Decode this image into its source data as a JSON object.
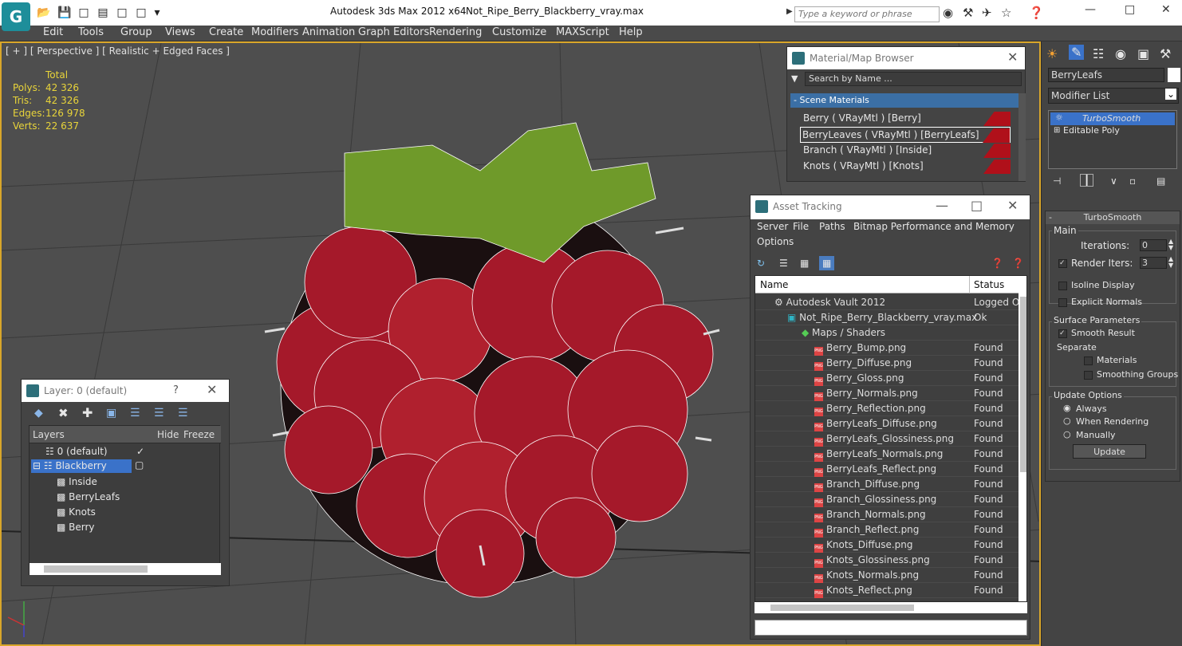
{
  "app": {
    "product": "Autodesk 3ds Max  2012 x64",
    "file": "Not_Ripe_Berry_Blackberry_vray.max",
    "search_placeholder": "Type a keyword or phrase"
  },
  "menu": [
    "Edit",
    "Tools",
    "Group",
    "Views",
    "Create",
    "Modifiers",
    "Animation",
    "Graph Editors",
    "Rendering",
    "Customize",
    "MAXScript",
    "Help"
  ],
  "viewport": {
    "label": "[ + ] [ Perspective ] [ Realistic + Edged Faces ]",
    "stats_header": "Total",
    "stats": [
      {
        "label": "Polys:",
        "value": "42 326"
      },
      {
        "label": "Tris:",
        "value": "42 326"
      },
      {
        "label": "Edges:",
        "value": "126 978"
      },
      {
        "label": "Verts:",
        "value": "22 637"
      }
    ]
  },
  "material_browser": {
    "title": "Material/Map Browser",
    "search": "Search by Name ...",
    "group": "- Scene Materials",
    "items": [
      "Berry  ( VRayMtl ) [Berry]",
      "BerryLeaves  ( VRayMtl ) [BerryLeafs]",
      "Branch  ( VRayMtl ) [Inside]",
      "Knots  ( VRayMtl ) [Knots]"
    ]
  },
  "asset_tracking": {
    "title": "Asset Tracking",
    "menus": [
      "Server",
      "File",
      "Paths",
      "Bitmap Performance and Memory",
      "Options"
    ],
    "col_name": "Name",
    "col_status": "Status",
    "rows": [
      {
        "name": "Autodesk Vault 2012",
        "status": "Logged O"
      },
      {
        "name": "Not_Ripe_Berry_Blackberry_vray.max",
        "status": "Ok"
      },
      {
        "name": "Maps / Shaders",
        "status": ""
      },
      {
        "name": "Berry_Bump.png",
        "status": "Found"
      },
      {
        "name": "Berry_Diffuse.png",
        "status": "Found"
      },
      {
        "name": "Berry_Gloss.png",
        "status": "Found"
      },
      {
        "name": "Berry_Normals.png",
        "status": "Found"
      },
      {
        "name": "Berry_Reflection.png",
        "status": "Found"
      },
      {
        "name": "BerryLeafs_Diffuse.png",
        "status": "Found"
      },
      {
        "name": "BerryLeafs_Glossiness.png",
        "status": "Found"
      },
      {
        "name": "BerryLeafs_Normals.png",
        "status": "Found"
      },
      {
        "name": "BerryLeafs_Reflect.png",
        "status": "Found"
      },
      {
        "name": "Branch_Diffuse.png",
        "status": "Found"
      },
      {
        "name": "Branch_Glossiness.png",
        "status": "Found"
      },
      {
        "name": "Branch_Normals.png",
        "status": "Found"
      },
      {
        "name": "Branch_Reflect.png",
        "status": "Found"
      },
      {
        "name": "Knots_Diffuse.png",
        "status": "Found"
      },
      {
        "name": "Knots_Glossiness.png",
        "status": "Found"
      },
      {
        "name": "Knots_Normals.png",
        "status": "Found"
      },
      {
        "name": "Knots_Reflect.png",
        "status": "Found"
      }
    ]
  },
  "layer_panel": {
    "title": "Layer: 0 (default)",
    "help": "?",
    "col_layers": "Layers",
    "col_hide": "Hide",
    "col_freeze": "Freeze",
    "rows": [
      "0 (default)",
      "Blackberry",
      "Inside",
      "BerryLeafs",
      "Knots",
      "Berry"
    ]
  },
  "command_panel": {
    "object_name": "BerryLeafs",
    "modifier_list": "Modifier List",
    "stack": [
      "TurboSmooth",
      "Editable Poly"
    ],
    "rollout": "TurboSmooth",
    "main": "Main",
    "iterations_label": "Iterations:",
    "iterations": "0",
    "render_iters_label": "Render Iters:",
    "render_iters": "3",
    "isoline": "Isoline Display",
    "explicit": "Explicit Normals",
    "surface": "Surface Parameters",
    "smooth": "Smooth Result",
    "separate": "Separate",
    "materials": "Materials",
    "smoothing": "Smoothing Groups",
    "update_options": "Update Options",
    "always": "Always",
    "when_rendering": "When Rendering",
    "manually": "Manually",
    "update": "Update"
  }
}
